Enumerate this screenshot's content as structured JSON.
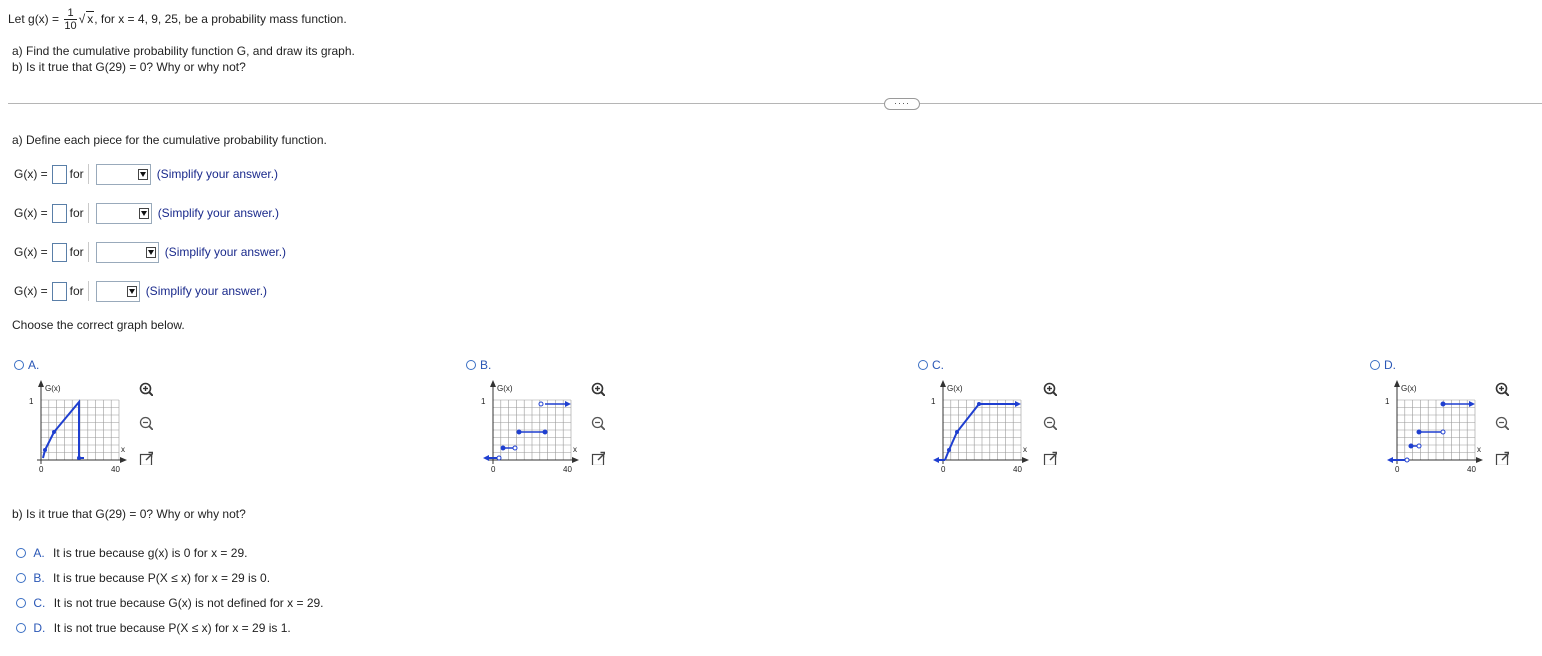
{
  "problem": {
    "let_prefix": "Let g(x) =",
    "frac_num": "1",
    "frac_den": "10",
    "sqrt_sym": "√",
    "sqrt_arg": "x",
    "let_suffix": ", for x = 4, 9, 25, be a probability mass function.",
    "part_a": "a) Find the cumulative probability function G, and draw its graph.",
    "part_b": "b) Is it true that G(29) = 0? Why or why not?"
  },
  "more_button": "····",
  "section_a": {
    "heading": "a) Define each piece for the cumulative probability function.",
    "rows": [
      {
        "prefix": "G(x) =",
        "for": "for",
        "hint": "(Simplify your answer.)"
      },
      {
        "prefix": "G(x) =",
        "for": "for",
        "hint": "(Simplify your answer.)"
      },
      {
        "prefix": "G(x) =",
        "for": "for",
        "hint": "(Simplify your answer.)"
      },
      {
        "prefix": "G(x) =",
        "for": "for",
        "hint": "(Simplify your answer.)"
      }
    ],
    "choose_graph": "Choose the correct graph below."
  },
  "graph_options": [
    {
      "label": "A.",
      "y_label": "G(x)",
      "x_label": "x",
      "y_tick": "1",
      "x0": "0",
      "x_tick": "40"
    },
    {
      "label": "B.",
      "y_label": "G(x)",
      "x_label": "x",
      "y_tick": "1",
      "x0": "0",
      "x_tick": "40"
    },
    {
      "label": "C.",
      "y_label": "G(x)",
      "x_label": "x",
      "y_tick": "1",
      "x0": "0",
      "x_tick": "40"
    },
    {
      "label": "D.",
      "y_label": "G(x)",
      "x_label": "x",
      "y_tick": "1",
      "x0": "0",
      "x_tick": "40"
    }
  ],
  "tool_icons": [
    "zoom-in-icon",
    "zoom-out-icon",
    "open-external-icon"
  ],
  "section_b": {
    "heading": "b) Is it true that G(29) = 0? Why or why not?",
    "options": [
      {
        "label": "A.",
        "text": "It is true because g(x) is 0 for x = 29."
      },
      {
        "label": "B.",
        "text": "It is true because P(X ≤ x) for x = 29 is 0."
      },
      {
        "label": "C.",
        "text": "It is not true because G(x) is not defined for x = 29."
      },
      {
        "label": "D.",
        "text": "It is not true because P(X ≤ x) for x = 29 is 1."
      }
    ]
  },
  "colors": {
    "accent": "#3a6fc4",
    "plot_line": "#1f3fd0",
    "hint_text": "#1a2a8c",
    "grid": "#9a9a9a"
  }
}
